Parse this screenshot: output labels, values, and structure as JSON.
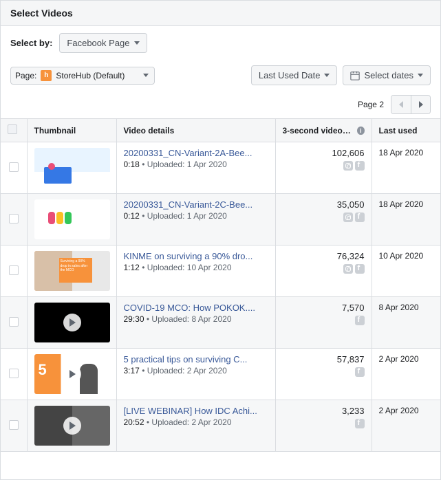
{
  "header": {
    "title": "Select Videos"
  },
  "toolbar": {
    "select_by_label": "Select by:",
    "select_by_value": "Facebook Page"
  },
  "filters": {
    "page_label": "Page:",
    "page_value": "StoreHub (Default)",
    "sort_label": "Last Used Date",
    "date_label": "Select dates"
  },
  "pager": {
    "label": "Page 2",
    "prev_disabled": false,
    "next_disabled": false
  },
  "columns": {
    "checkbox": "",
    "thumbnail": "Thumbnail",
    "details": "Video details",
    "views": "3-second video vie…",
    "last_used": "Last used"
  },
  "rows": [
    {
      "thumb_class": "t1",
      "show_play": false,
      "title": "20200331_CN-Variant-2A-Bee...",
      "duration": "0:18",
      "uploaded": "Uploaded: 1 Apr 2020",
      "views": "102,606",
      "platforms": [
        "ig",
        "fb"
      ],
      "last_used": "18 Apr 2020",
      "alt": false
    },
    {
      "thumb_class": "t2",
      "show_play": false,
      "title": "20200331_CN-Variant-2C-Bee...",
      "duration": "0:12",
      "uploaded": "Uploaded: 1 Apr 2020",
      "views": "35,050",
      "platforms": [
        "ig",
        "fb"
      ],
      "last_used": "18 Apr 2020",
      "alt": true
    },
    {
      "thumb_class": "t3",
      "show_play": false,
      "title": "KINME on surviving a 90% dro...",
      "duration": "1:12",
      "uploaded": "Uploaded: 10 Apr 2020",
      "views": "76,324",
      "platforms": [
        "ig",
        "fb"
      ],
      "last_used": "10 Apr 2020",
      "alt": false
    },
    {
      "thumb_class": "t4",
      "show_play": true,
      "title": "COVID-19 MCO: How POKOK....",
      "duration": "29:30",
      "uploaded": "Uploaded: 8 Apr 2020",
      "views": "7,570",
      "platforms": [
        "fb"
      ],
      "last_used": "8 Apr 2020",
      "alt": true
    },
    {
      "thumb_class": "t5",
      "show_play": true,
      "title": "5 practical tips on surviving C...",
      "duration": "3:17",
      "uploaded": "Uploaded: 2 Apr 2020",
      "views": "57,837",
      "platforms": [
        "fb"
      ],
      "last_used": "2 Apr 2020",
      "alt": false
    },
    {
      "thumb_class": "t6",
      "show_play": true,
      "title": "[LIVE WEBINAR] How IDC Achi...",
      "duration": "20:52",
      "uploaded": "Uploaded: 2 Apr 2020",
      "views": "3,233",
      "platforms": [
        "fb"
      ],
      "last_used": "2 Apr 2020",
      "alt": true
    }
  ]
}
